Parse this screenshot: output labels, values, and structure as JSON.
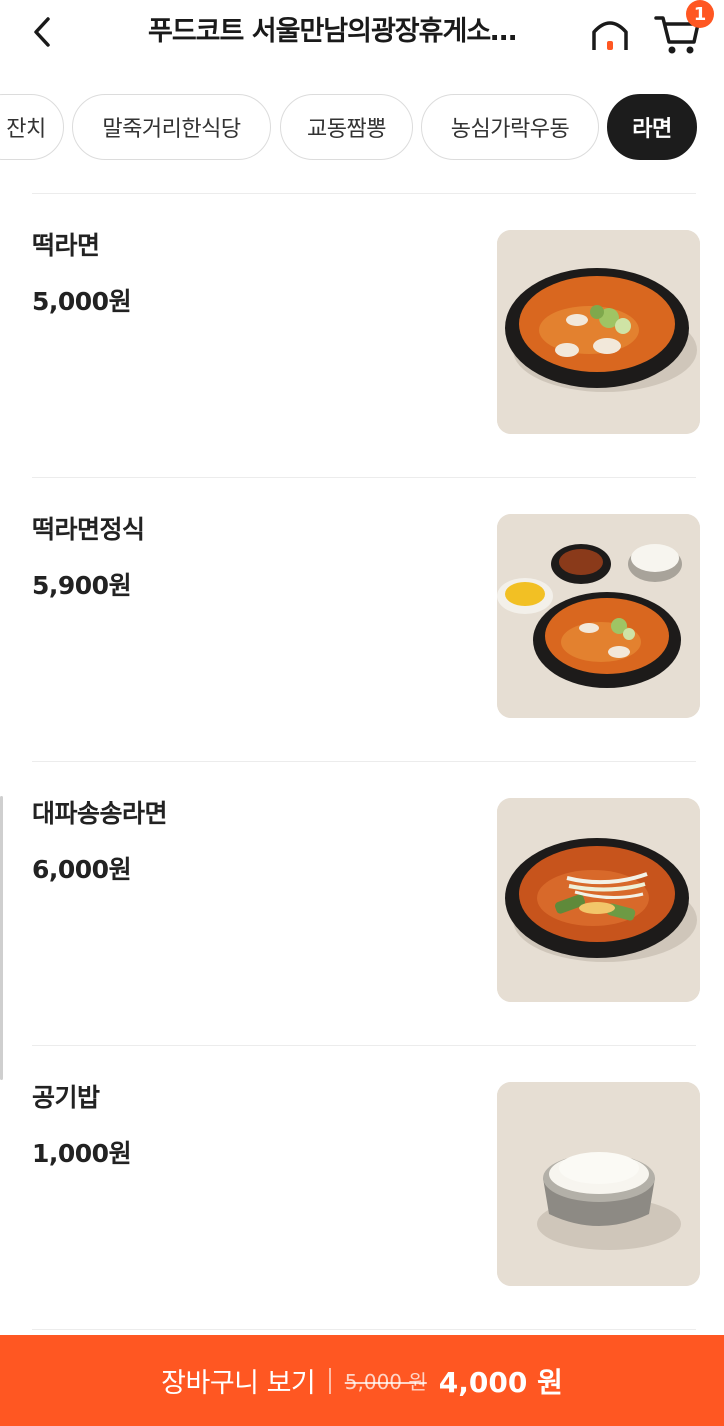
{
  "header": {
    "title": "푸드코트 서울만남의광장휴게소…",
    "cart_count": "1"
  },
  "tabs": [
    {
      "label": "잔치"
    },
    {
      "label": "말죽거리한식당"
    },
    {
      "label": "교동짬뽕"
    },
    {
      "label": "농심가락우동"
    },
    {
      "label": "라면"
    }
  ],
  "menu": [
    {
      "name": "떡라면",
      "price": "5,000원",
      "image": "spicy-ramen-bowl-image"
    },
    {
      "name": "떡라면정식",
      "price": "5,900원",
      "image": "ramen-set-meal-image"
    },
    {
      "name": "대파송송라면",
      "price": "6,000원",
      "image": "green-onion-ramen-image"
    },
    {
      "name": "공기밥",
      "price": "1,000원",
      "image": "rice-bowl-image"
    }
  ],
  "bottom_bar": {
    "label": "장바구니 보기",
    "original_price": "5,000 원",
    "final_price": "4,000 원"
  },
  "colors": {
    "accent": "#ff5722",
    "active_tab": "#1c1c1c"
  }
}
